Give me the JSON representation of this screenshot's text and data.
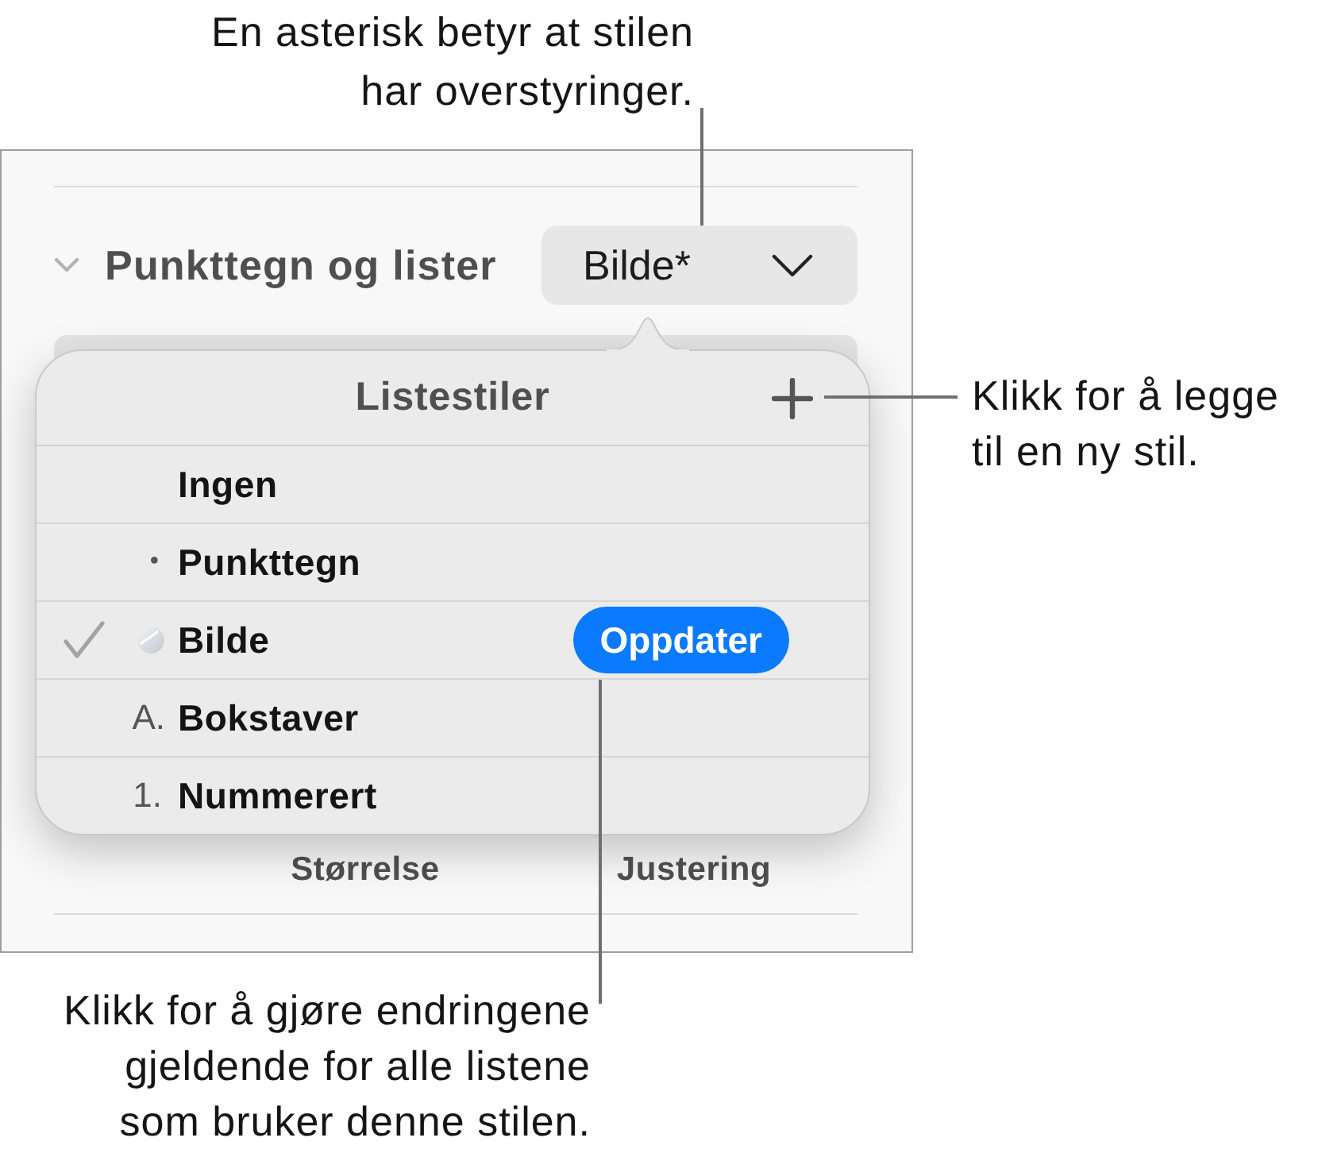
{
  "callouts": [
    {
      "kind": "top",
      "lines": [
        "En asterisk betyr at stilen",
        "har overstyringer."
      ]
    },
    {
      "kind": "right",
      "lines": [
        "Klikk for å legge",
        "til en ny stil."
      ]
    },
    {
      "kind": "bottom",
      "lines": [
        "Klikk for å gjøre endringene",
        "gjeldende for alle listene",
        "som bruker denne stilen."
      ]
    }
  ],
  "inspector": {
    "section": {
      "title": "Punkttegn og lister",
      "expanded": true
    },
    "style_menu": {
      "value": "Bilde*"
    },
    "labels": [
      "Størrelse",
      "Justering"
    ]
  },
  "popover": {
    "title": "Listestiler",
    "items": [
      {
        "label": "Ingen",
        "kind": "none",
        "selected": false
      },
      {
        "label": "Punkttegn",
        "kind": "bullet",
        "marker": "•",
        "selected": false
      },
      {
        "label": "Bilde",
        "kind": "image",
        "selected": true,
        "action": "Oppdater"
      },
      {
        "label": "Bokstaver",
        "kind": "letter",
        "marker": "A.",
        "selected": false
      },
      {
        "label": "Nummerert",
        "kind": "number",
        "marker": "1.",
        "selected": false
      }
    ]
  }
}
